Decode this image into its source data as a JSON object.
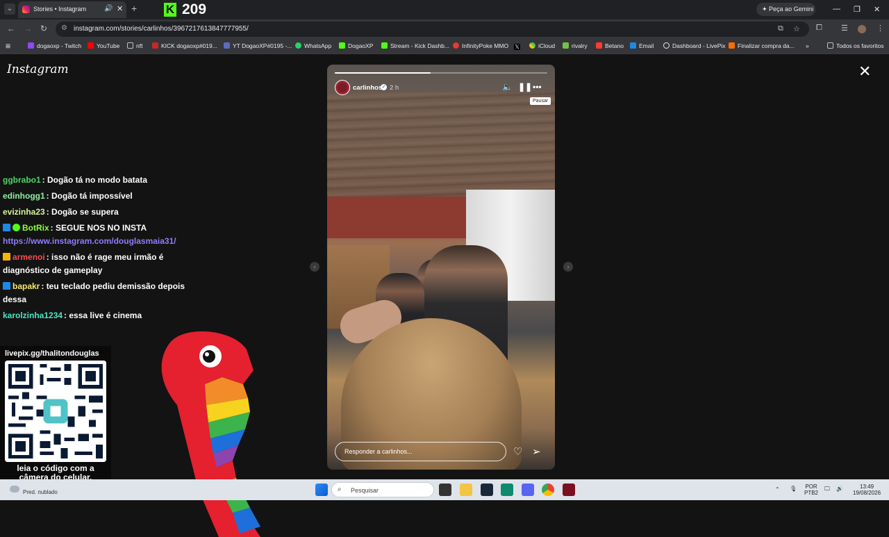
{
  "browser": {
    "tab_title": "Stories • Instagram",
    "kick_count": "209",
    "gemini_label": "Peça ao Gemini",
    "url": "instagram.com/stories/carlinhos/3967217613847777955/",
    "bookmarks": [
      "dogaoxp - Twitch",
      "YouTube",
      "nft",
      "KICK dogaoxp#019...",
      "YT DogaoXP#0195 -...",
      "WhatsApp",
      "DogaoXP",
      "Stream - Kick Dashb...",
      "InfinityPoke MMO",
      "iCloud",
      "rivalry",
      "Betano",
      "Email",
      "Dashboard - LivePix",
      "Finalizar compra da..."
    ],
    "all_favorites": "Todos os favoritos"
  },
  "instagram": {
    "logo": "Instagram",
    "story": {
      "username": "carlinhos",
      "time": "2 h",
      "tooltip": "Pausar",
      "reply_placeholder": "Responder a carlinhos...",
      "progress": 0.45
    }
  },
  "chat": [
    {
      "user": "ggbrabo1",
      "color": "#4cd964",
      "msg": ": Dogão tá no modo batata"
    },
    {
      "user": "edinhogg1",
      "color": "#8ef0a0",
      "msg": ": Dogão tá impossível"
    },
    {
      "user": "evizinha23",
      "color": "#d6f59a",
      "msg": ": Dogão se supera"
    },
    {
      "user": "BotRix",
      "color": "#8aff3c",
      "msg": ": SEGUE NOS NO INSTA",
      "link": "https://www.instagram.com/douglasmaia31/"
    },
    {
      "user": "armenoi",
      "color": "#ff4b4b",
      "msg": ": isso não é rage meu irmão é diagnóstico de gameplay"
    },
    {
      "user": "bapakr",
      "color": "#f5e96a",
      "msg": ": teu teclado pediu demissão depois dessa"
    },
    {
      "user": "karolzinha1234",
      "color": "#4ee3c4",
      "msg": ": essa live é cinema"
    }
  ],
  "overlay": {
    "qr_url": "livepix.gg/thalitondouglas",
    "qr_caption": "leia o código com a câmera do celular."
  },
  "taskbar": {
    "weather": "Pred. nublado",
    "search": "Pesquisar",
    "lang": "POR",
    "lang2": "PTB2",
    "time": "13:49",
    "date": "19/08/2026"
  }
}
